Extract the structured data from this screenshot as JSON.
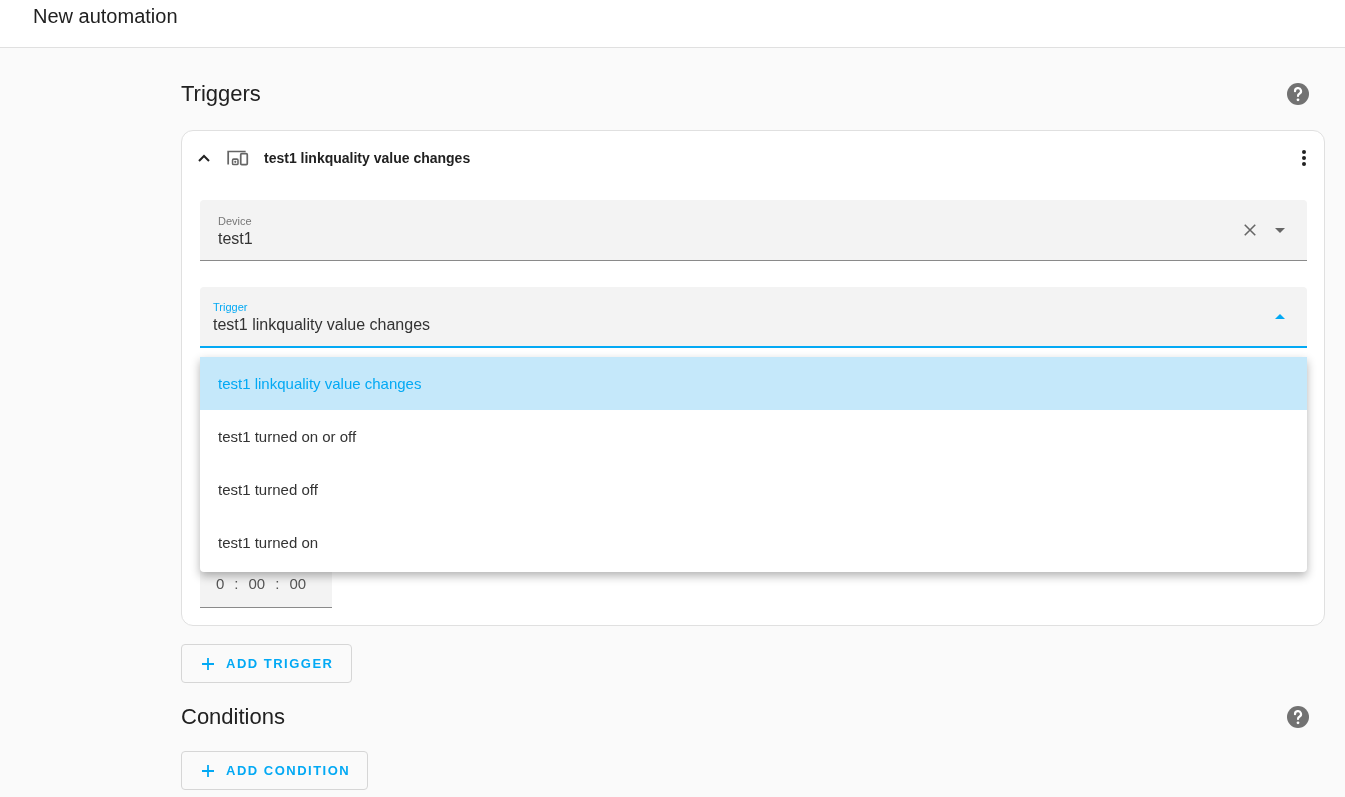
{
  "header": {
    "title": "New automation"
  },
  "triggers_section": {
    "heading": "Triggers",
    "card": {
      "title": "test1 linkquality value changes",
      "expanded": true,
      "device_field": {
        "label": "Device",
        "value": "test1",
        "clearable": true
      },
      "trigger_field": {
        "label": "Trigger",
        "value": "test1 linkquality value changes",
        "expanded": true,
        "options": [
          {
            "label": "test1 linkquality value changes",
            "selected": true
          },
          {
            "label": "test1 turned on or off",
            "selected": false
          },
          {
            "label": "test1 turned off",
            "selected": false
          },
          {
            "label": "test1 turned on",
            "selected": false
          }
        ]
      },
      "duration_field": {
        "parts": [
          "0",
          "00",
          "00"
        ],
        "separators": [
          ":",
          ":"
        ]
      }
    },
    "add_button": {
      "label": "ADD TRIGGER"
    }
  },
  "conditions_section": {
    "heading": "Conditions",
    "add_button": {
      "label": "ADD CONDITION"
    }
  }
}
